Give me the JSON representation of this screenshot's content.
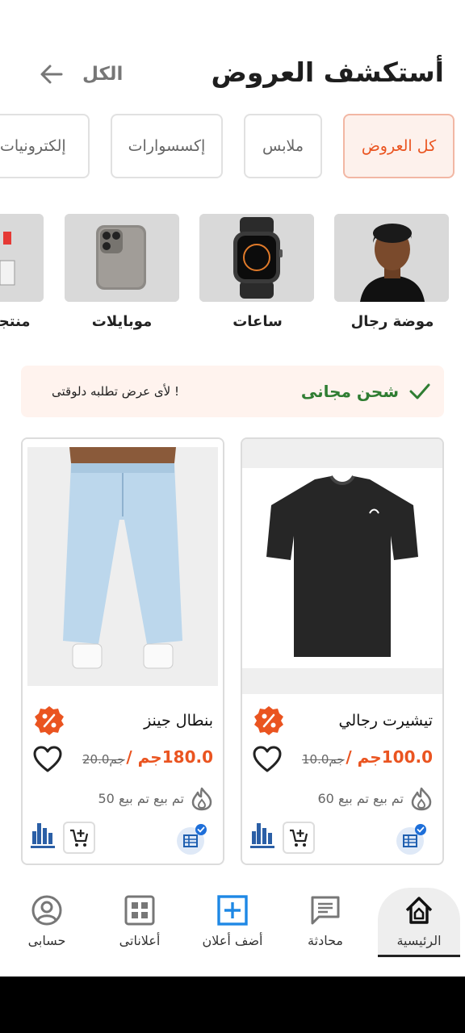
{
  "header": {
    "title": "أستكشف العروض",
    "see_all": "الكل"
  },
  "chips": [
    {
      "label": "كل العروض",
      "active": true
    },
    {
      "label": "ملابس",
      "active": false
    },
    {
      "label": "إكسسوارات",
      "active": false
    },
    {
      "label": "إلكترونيات",
      "active": false
    }
  ],
  "categories": [
    {
      "label": "موضة رجال",
      "image": "man-portrait"
    },
    {
      "label": "ساعات",
      "image": "smartwatch"
    },
    {
      "label": "موبايلات",
      "image": "smartphone"
    },
    {
      "label": "منتجا",
      "image": "product"
    }
  ],
  "banner": {
    "title": "شحن مجانى",
    "subtitle": "لأى عرض تطلبه دلوقتى !"
  },
  "products": [
    {
      "name": "تيشيرت رجالي",
      "price": "100.0جم /",
      "old_price": "10.0جم",
      "sold": "تم بيع تم بيع 60",
      "image": "black-tshirt"
    },
    {
      "name": "بنطال جينز",
      "price": "180.0جم /",
      "old_price": "20.0جم",
      "sold": "تم بيع تم بيع 50",
      "image": "blue-jeans"
    }
  ],
  "nav": {
    "home": "الرئيسية",
    "chat": "محادثة",
    "add_ad": "أضف أعلان",
    "my_ads": "أعلاناتى",
    "account": "حسابى"
  },
  "colors": {
    "accent": "#ea5420",
    "success": "#2f7d32",
    "nav_icon": "#777777",
    "add_icon": "#1e88e5"
  }
}
